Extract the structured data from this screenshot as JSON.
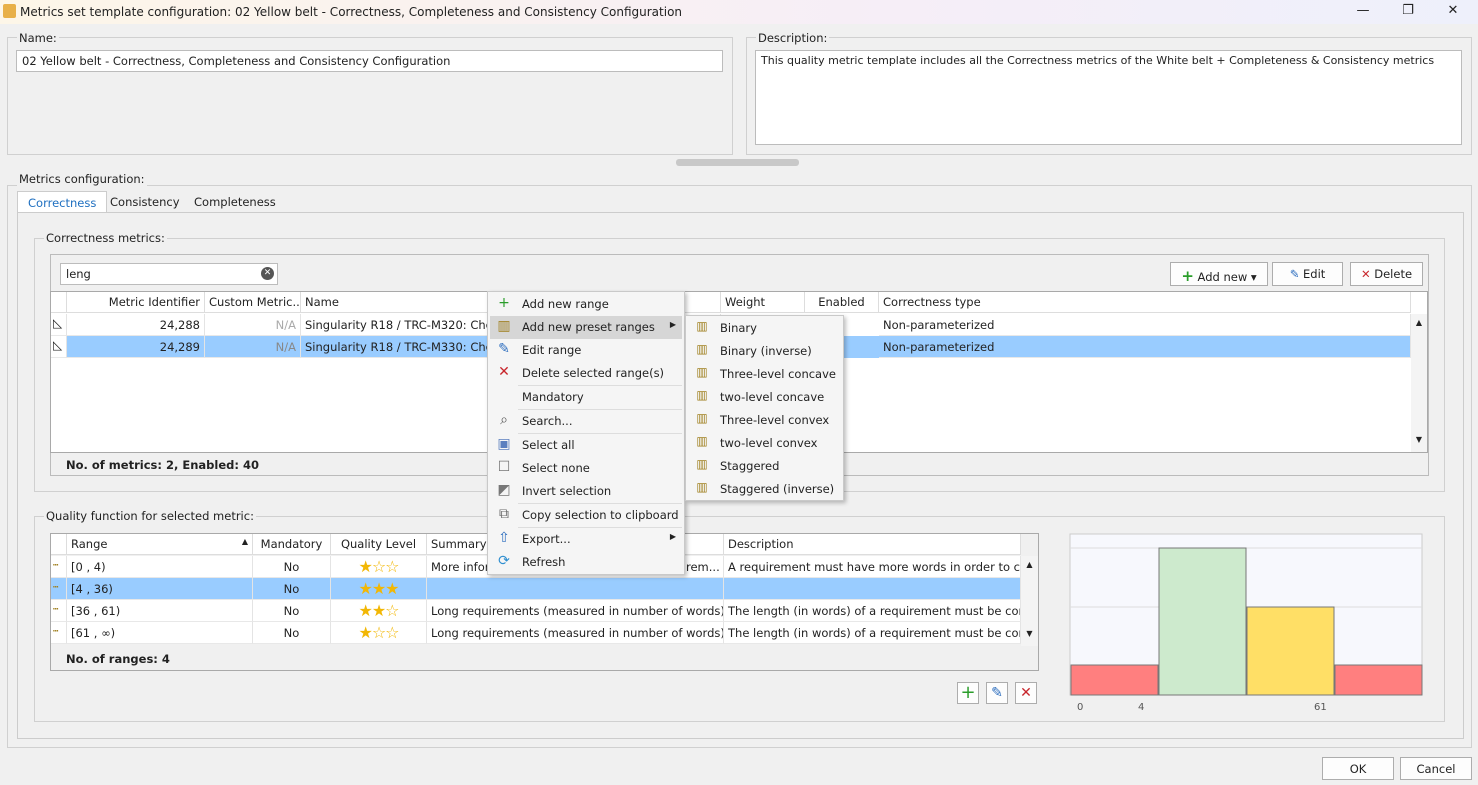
{
  "window": {
    "title": "Metrics set template configuration: 02 Yellow belt - Correctness, Completeness and Consistency Configuration",
    "minimize": "—",
    "restore": "❐",
    "close": "✕"
  },
  "name": {
    "label": "Name:",
    "value": "02 Yellow belt - Correctness, Completeness and Consistency Configuration"
  },
  "description": {
    "label": "Description:",
    "value": "This quality metric template includes all the Correctness metrics of the White belt + Completeness & Consistency metrics"
  },
  "metrics_config": {
    "label": "Metrics configuration:",
    "tabs": [
      "Correctness",
      "Consistency",
      "Completeness"
    ],
    "active_tab": "Correctness"
  },
  "correctness": {
    "label": "Correctness metrics:",
    "search": "leng",
    "buttons": {
      "add": "Add new",
      "edit": "Edit",
      "delete": "Delete"
    },
    "columns": [
      "Metric Identifier",
      "Custom Metric...",
      "Name",
      "Weight",
      "Enabled",
      "Correctness type"
    ],
    "rows": [
      {
        "id": "24,288",
        "custom": "N/A",
        "name": "Singularity R18 / TRC-M320: Check t",
        "type": "Non-parameterized"
      },
      {
        "id": "24,289",
        "custom": "N/A",
        "name": "Singularity R18 / TRC-M330: Check t",
        "type": "Non-parameterized",
        "selected": true
      }
    ],
    "footer": "No. of metrics: 2, Enabled: 40"
  },
  "quality": {
    "label": "Quality function for selected metric:",
    "columns": [
      "Range",
      "Mandatory",
      "Quality Level",
      "Summary",
      "Description"
    ],
    "rows": [
      {
        "range": "[0 , 4)",
        "mandatory": "No",
        "stars": 1,
        "summary": "More infor",
        "summary_tail": "rem...",
        "description": "A requirement must have more words in order to conv..."
      },
      {
        "range": "[4 , 36)",
        "mandatory": "No",
        "stars": 3,
        "summary": "",
        "summary_tail": "",
        "description": "",
        "selected": true
      },
      {
        "range": "[36 , 61)",
        "mandatory": "No",
        "stars": 2,
        "summary": "Long requirements (measured in number of words) m...",
        "summary_tail": "",
        "description": "The length (in words) of a requirement must be control..."
      },
      {
        "range": "[61 , ∞)",
        "mandatory": "No",
        "stars": 1,
        "summary": "Long requirements (measured in number of words) m...",
        "summary_tail": "",
        "description": "The length (in words) of a requirement must be control..."
      }
    ],
    "footer": "No. of ranges: 4"
  },
  "chart_data": {
    "type": "bar",
    "categories": [
      "[0 , 4)",
      "[4 , 36)",
      "[36 , 61)",
      "[61 , ∞)"
    ],
    "values": [
      1,
      3,
      2,
      1
    ],
    "colors": [
      "#ff7f7f",
      "#cdeacd",
      "#ffdf66",
      "#ff7f7f"
    ],
    "x_tick_labels": [
      "0",
      "4",
      "61"
    ],
    "ylim": [
      0,
      3
    ]
  },
  "context_menu": {
    "items": [
      {
        "label": "Add new range",
        "icon": "plus-icon"
      },
      {
        "label": "Add new preset ranges",
        "icon": "preset-icon",
        "submenu": true,
        "highlighted": true
      },
      {
        "label": "Edit range",
        "icon": "pencil-icon"
      },
      {
        "label": "Delete selected range(s)",
        "icon": "x-icon"
      },
      {
        "label": "Mandatory",
        "icon": ""
      },
      {
        "label": "Search...",
        "icon": "search-icon"
      },
      {
        "label": "Select all",
        "icon": "select-all-icon"
      },
      {
        "label": "Select none",
        "icon": "select-none-icon"
      },
      {
        "label": "Invert selection",
        "icon": "invert-icon"
      },
      {
        "label": "Copy selection to clipboard",
        "icon": "copy-icon"
      },
      {
        "label": "Export...",
        "icon": "export-icon",
        "submenu": true
      },
      {
        "label": "Refresh",
        "icon": "refresh-icon"
      }
    ]
  },
  "submenu": {
    "items": [
      "Binary",
      "Binary (inverse)",
      "Three-level concave",
      "two-level concave",
      "Three-level convex",
      "two-level convex",
      "Staggered",
      "Staggered (inverse)"
    ]
  },
  "dialog": {
    "ok": "OK",
    "cancel": "Cancel"
  }
}
